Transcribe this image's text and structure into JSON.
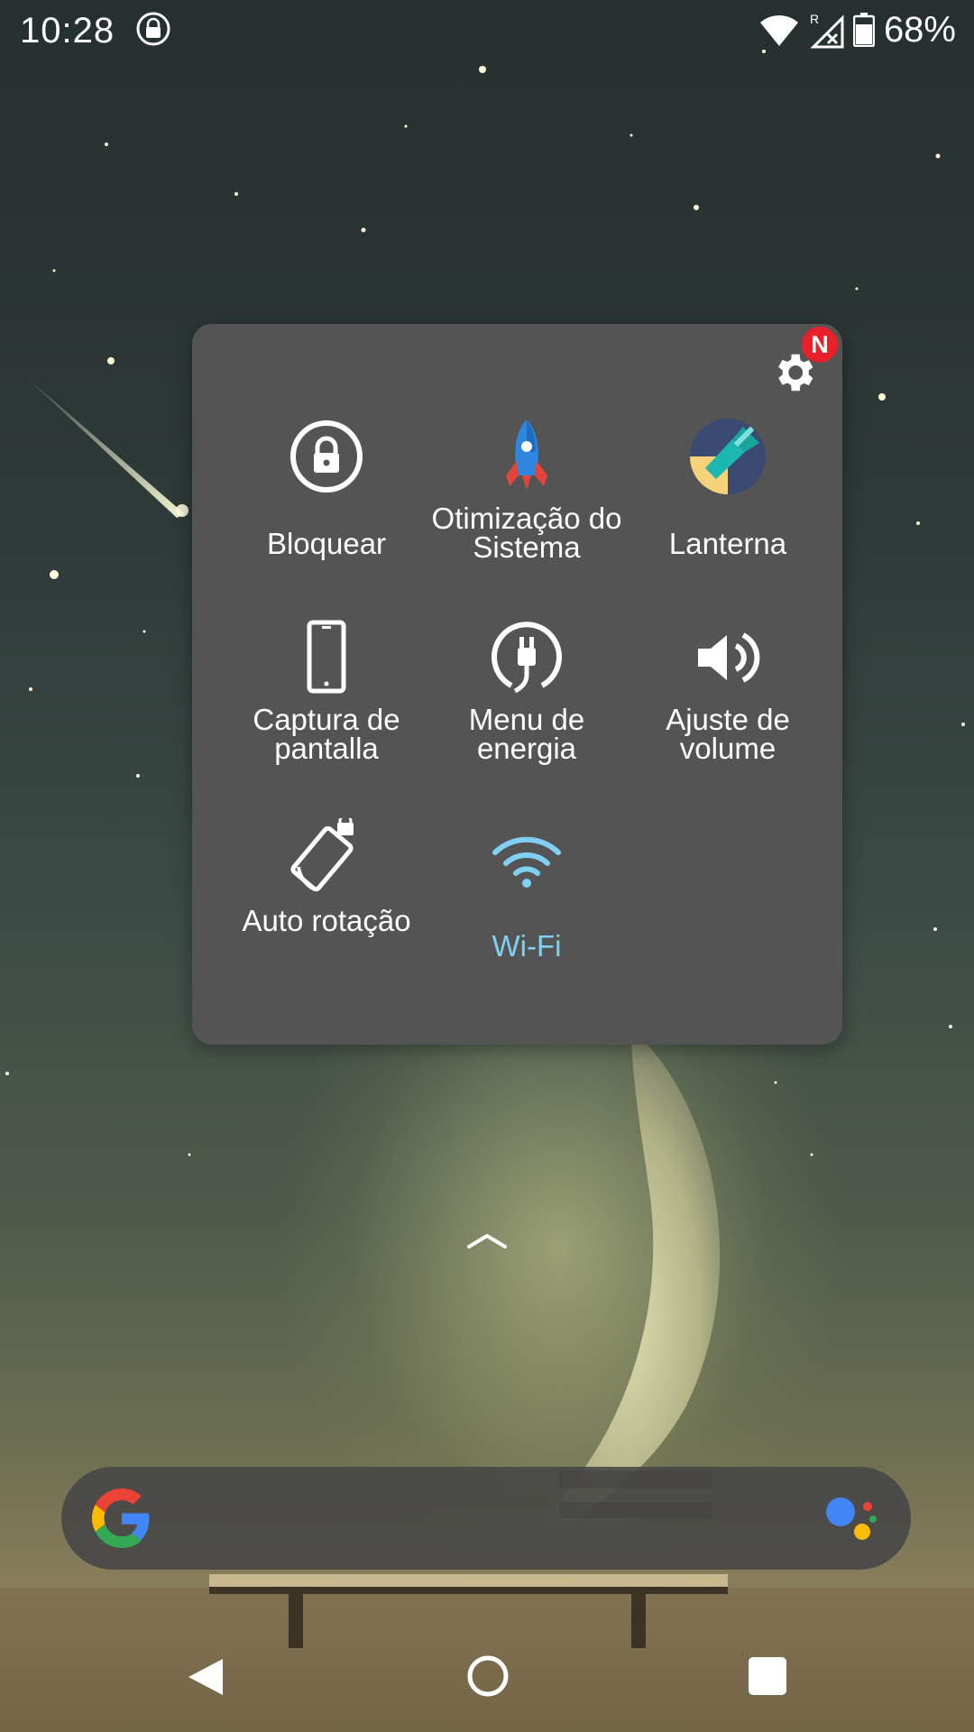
{
  "status_bar": {
    "time": "10:28",
    "battery": "68%",
    "icons": [
      "lock-icon",
      "wifi-icon",
      "signal-roaming-icon",
      "battery-icon"
    ]
  },
  "panel": {
    "settings_badge": "N",
    "tiles": [
      {
        "label": "Bloquear",
        "icon": "lock-icon"
      },
      {
        "label": "Otimização do Sistema",
        "icon": "rocket-icon"
      },
      {
        "label": "Lanterna",
        "icon": "flashlight-icon"
      },
      {
        "label": "Captura de pantalla",
        "icon": "phone-icon"
      },
      {
        "label": "Menu de energia",
        "icon": "power-plug-icon"
      },
      {
        "label": "Ajuste de volume",
        "icon": "volume-icon"
      },
      {
        "label": "Auto rotação",
        "icon": "rotation-lock-icon"
      },
      {
        "label": "Wi-Fi",
        "icon": "wifi-icon"
      }
    ]
  },
  "colors": {
    "panel_bg": "#545454",
    "wifi_accent": "#7fd0f2",
    "badge": "#e8202a"
  },
  "search_bar": {
    "icons": [
      "google-logo",
      "assistant-icon"
    ]
  },
  "nav_bar": {
    "icons": [
      "back-icon",
      "home-icon",
      "recents-icon"
    ]
  }
}
